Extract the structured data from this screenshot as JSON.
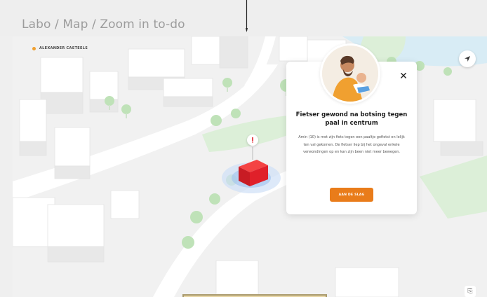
{
  "header": {
    "breadcrumb": "Labo / Map / Zoom in to-do"
  },
  "map": {
    "brand_name": "ALEXANDER CASTEELS",
    "locate_icon": "navigation-arrow-icon",
    "incident_icon": "exclamation-icon",
    "bottom_icon": "share-icon",
    "bottom_icon_glyph": "⎘"
  },
  "incident_card": {
    "title": "Fietser gewond na botsing tegen paal in centrum",
    "body": "Amin (10) is met zijn fiets tegen een paaltje gefietst en lelijk ten val gekomen. De fietser liep bij het ongeval enkele verwondingen op en kan zijn been niet meer bewegen.",
    "cta_label": "AAN DE SLAG",
    "close_glyph": "✕"
  },
  "colors": {
    "accent": "#e97c1a",
    "incident": "#e0202a",
    "grass": "#dcefd8",
    "tree": "#bfe2b8",
    "water": "#d8ecf5"
  }
}
